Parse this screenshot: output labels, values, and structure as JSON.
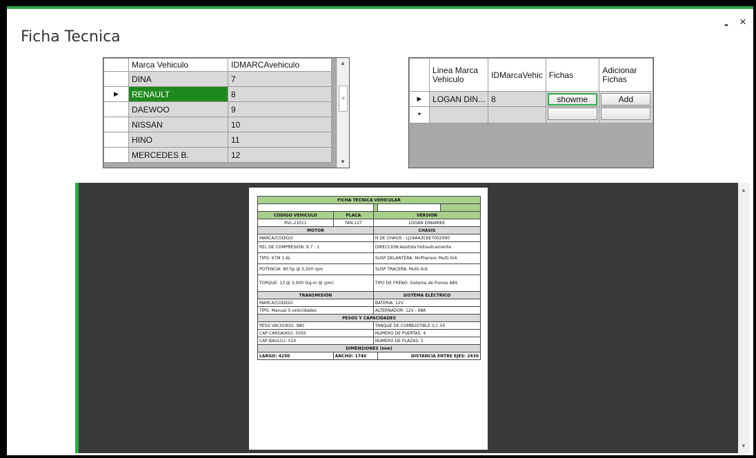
{
  "window": {
    "title": "Ficha Tecnica",
    "minimize": "-",
    "close": "×"
  },
  "marcas_grid": {
    "columns": [
      "Marca Vehiculo",
      "IDMARCAvehiculo"
    ],
    "rows": [
      {
        "marca": "DINA",
        "id": "7"
      },
      {
        "marca": "RENAULT",
        "id": "8"
      },
      {
        "marca": "DAEWOO",
        "id": "9"
      },
      {
        "marca": "NISSAN",
        "id": "10"
      },
      {
        "marca": "HINO",
        "id": "11"
      },
      {
        "marca": "MERCEDES B.",
        "id": "12"
      }
    ],
    "row_indicator": "▶",
    "scroll_up": "▲",
    "scroll_down": "▼",
    "scroll_thumb": "≡"
  },
  "lineas_grid": {
    "columns": [
      "Linea Marca Vehiculo",
      "IDMarcaVehic",
      "Fichas",
      "Adicionar Fichas"
    ],
    "row": {
      "linea": "LOGAN DIN...",
      "id": "8",
      "fichas": "showme",
      "adicionar": "Add"
    },
    "row_indicator": "▶",
    "new_row_indicator": "*"
  },
  "ficha": {
    "title": "FICHA TECNICA VEHICULAR",
    "codigo_label": "CODIGO VEHICULO",
    "placa_label": "PLACA",
    "version_label": "VERSION",
    "codigo": "RVL-21011",
    "placa": "TAN-127",
    "version": "LOGAN DINAMIKE",
    "motor_label": "MOTOR",
    "chasis_label": "CHASIS",
    "motor": [
      "MARCA/CODIGO:",
      "REL DE COMPRESION: 9,7 : 1",
      "TIPO:  K7M 1.6L",
      "POTENCIA: 90 hp @ 5,500  rpm",
      "TORQUE: 13 @ 3,000 (kg-m @ rpm)"
    ],
    "chasis": [
      "N DE CHASIS : LJ16AA3C6E7002090",
      "DIRECCION:Asistida hidraulicamente",
      "SUSP DELANTERA: McPherson Multi-link",
      "SUSP TRACERA: Multi-link",
      "TIPO DE FRENO: Sistema de Frenos ABS"
    ],
    "transmision_label": "TRANSMISIÒN",
    "electrico_label": "SISTEMA ELÈCTRICO",
    "transmision": [
      "MARCA/CODIGO:",
      "TIPO: Manual  5-velocidades"
    ],
    "electrico": [
      "BATERIA: 12V",
      "ALTERNADOR: 12V - 98A"
    ],
    "pesos_label": "PESOS Y CAPACIDADES",
    "pesos": [
      "PESO VACIO(KG):  980",
      "CAP CARGA(KG): 5050",
      "CAP BAUL(L):  510"
    ],
    "capacidades": [
      "TANQUE DE COMBUSTIBLE (L):  50",
      "NUMERO DE PUERTAS: 4",
      "NUMERO DE PLAZAS: 5"
    ],
    "dimensiones_label": "DIMENSIONES (mm)",
    "largo": "LARGO: 4250",
    "ancho": "ANCHO: 1740",
    "distancia": "DISTANCIA ENTRE EJES: 2630"
  },
  "colors": {
    "accent": "#2aa84a",
    "selection": "#1e8a1e",
    "viewer_bg": "#3a3a3a",
    "ficha_header": "#a8d08d"
  }
}
